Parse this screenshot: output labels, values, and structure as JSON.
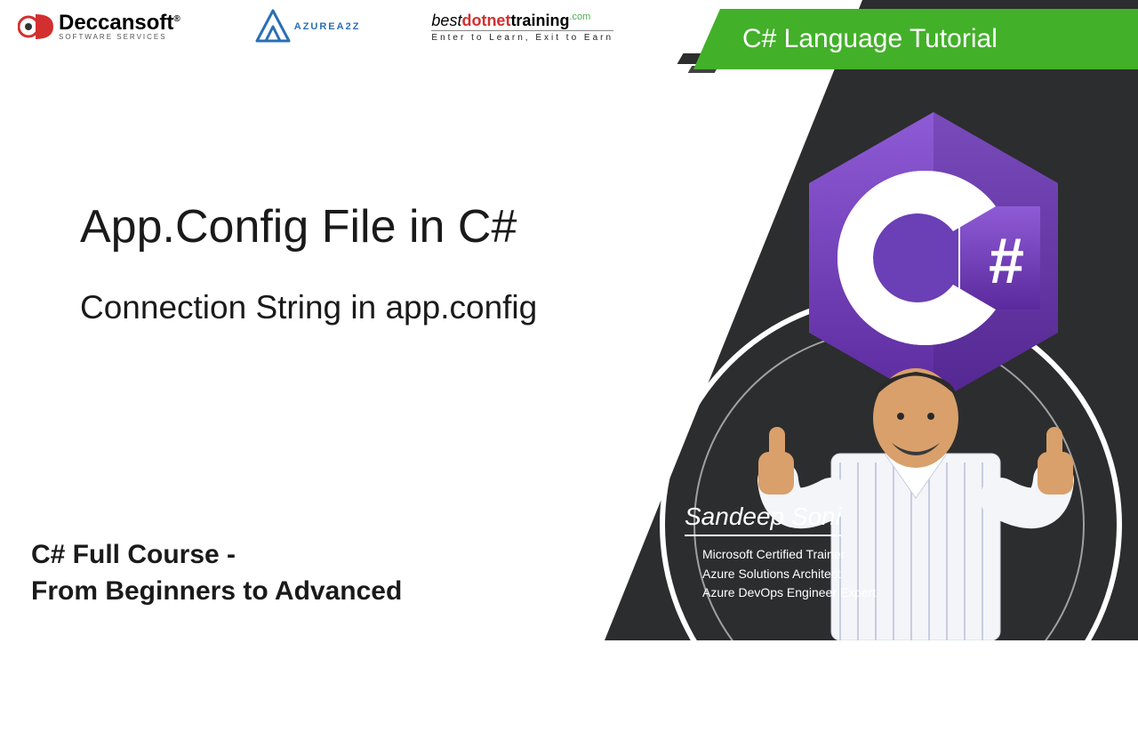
{
  "logos": {
    "deccansoft": {
      "name": "Deccansoft",
      "sub": "SOFTWARE SERVICES"
    },
    "azurea2z": {
      "label": "AZUREA2Z"
    },
    "bdt": {
      "best": "best",
      "dotnet": "dotnet",
      "training": "training",
      "com": ".com",
      "tagline": "Enter to Learn, Exit to Earn"
    }
  },
  "banner": {
    "text": "C# Language Tutorial"
  },
  "titles": {
    "main": "App.Config File in C#",
    "sub": "Connection String in app.config"
  },
  "course": {
    "line1": "C# Full Course -",
    "line2": "From Beginners to Advanced"
  },
  "presenter": {
    "name": "Sandeep Soni",
    "cred1": "Microsoft Certified Trainer",
    "cred2": "Azure Solutions Architect",
    "cred3": "Azure DevOps Engineer Expert"
  },
  "icons": {
    "csharp_hash": "#"
  }
}
